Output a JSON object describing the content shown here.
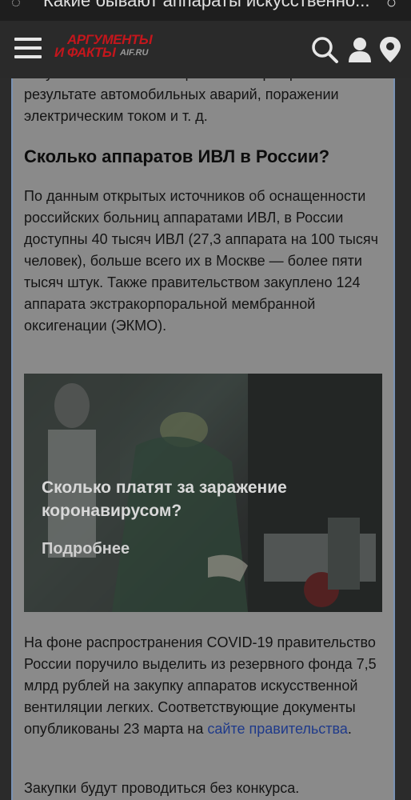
{
  "browser": {
    "tab_title": "Какие бывают аппараты искусственно..."
  },
  "header": {
    "logo_line1": "АРГУМЕНТЫ",
    "logo_line2": "И ФАКТЫ",
    "logo_domain": "AIF.RU",
    "icons": [
      "menu-icon",
      "search-icon",
      "user-icon",
      "location-icon"
    ]
  },
  "article": {
    "intro_partial": "искусственной вентиляции лёгких при травмах в результате автомобильных аварий, поражении электрическим током и т. д.",
    "heading": "Сколько аппаратов ИВЛ в России?",
    "paragraph2": "По данным открытых источников об оснащенности российских больниц аппаратами ИВЛ, в России доступны 40 тысяч ИВЛ (27,3 аппарата на 100 тысяч человек), больше всего их в Москве — более пяти тысяч штук. Также правительством закуплено 124 аппарата экстракорпоральной мембранной оксигенации (ЭКМО).",
    "promo": {
      "title": "Сколько платят за заражение коронавирусом?",
      "more": "Подробнее"
    },
    "paragraph3_before_link": "На фоне распространения COVID-19 правительство России поручило выделить из резервного фонда 7,5 млрд рублей на закупку аппаратов искусственной вентиляции легких. Соответствующие документы опубликованы 23 марта на ",
    "paragraph3_link": "сайте правительства",
    "paragraph3_after_link": ".",
    "paragraph4": "Закупки будут проводиться без конкурса."
  },
  "colors": {
    "overlay_bg": "#8a8a8a",
    "header_bg": "#2a2a2a",
    "logo_red": "#c4161c",
    "link_blue": "#1f3a8a"
  }
}
